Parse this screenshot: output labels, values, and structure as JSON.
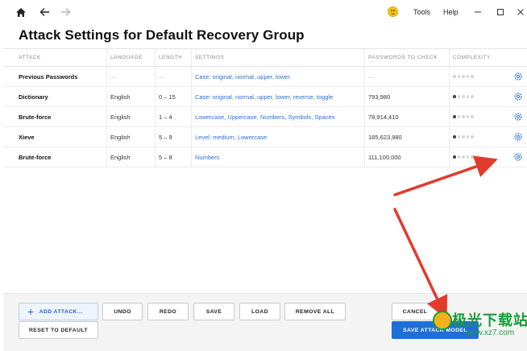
{
  "titlebar": {
    "tools_label": "Tools",
    "help_label": "Help",
    "icons": [
      "home-icon",
      "back-arrow-icon",
      "forward-arrow-icon",
      "smiley-icon",
      "minimize-icon",
      "maximize-icon",
      "close-icon"
    ]
  },
  "page_title": "Attack Settings for Default Recovery Group",
  "table": {
    "headers": {
      "attack": "ATTACK",
      "language": "LANGUAGE",
      "length": "LENGTH",
      "settings": "SETTINGS",
      "passwords": "PASSWORDS TO CHECK",
      "complexity": "COMPLEXITY"
    },
    "rows": [
      {
        "attack": "Previous Passwords",
        "language": "—",
        "length": "—",
        "settings": "Case: original, normal, upper, lower",
        "passwords": "—",
        "complexity": 0
      },
      {
        "attack": "Dictionary",
        "language": "English",
        "length": "0 – 15",
        "settings": "Case: original, normal, upper, lower, reverse, toggle",
        "passwords": "793,980",
        "complexity": 1
      },
      {
        "attack": "Brute-force",
        "language": "English",
        "length": "1 – 4",
        "settings": "Lowercase, Uppercase, Numbers, Symbols, Spaces",
        "passwords": "78,914,410",
        "complexity": 1
      },
      {
        "attack": "Xieve",
        "language": "English",
        "length": "5 – 9",
        "settings": "Level: medium, Lowercase",
        "passwords": "185,623,980",
        "complexity": 1
      },
      {
        "attack": "Brute-force",
        "language": "English",
        "length": "5 – 8",
        "settings": "Numbers",
        "passwords": "111,100,000",
        "complexity": 1
      }
    ]
  },
  "buttons": {
    "add_attack": "ADD ATTACK...",
    "undo": "UNDO",
    "redo": "REDO",
    "save": "SAVE",
    "load": "LOAD",
    "remove_all": "REMOVE ALL",
    "reset_default": "RESET TO DEFAULT",
    "cancel": "CANCEL",
    "save_model": "SAVE ATTACK MODEL"
  },
  "watermark": {
    "text": "极光下载站",
    "url": "www.xz7.com"
  },
  "colors": {
    "accent": "#1f6fd8",
    "link": "#2a6fd6",
    "annotation_arrow": "#e23a2b"
  }
}
